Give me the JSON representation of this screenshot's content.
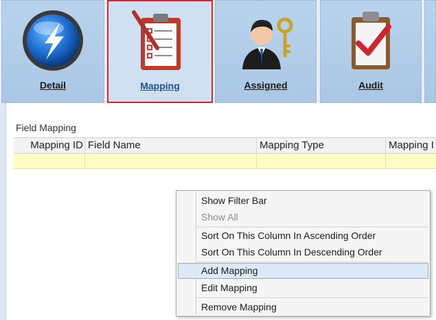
{
  "tabs": [
    {
      "label": "Detail",
      "icon": "lightning-globe-icon"
    },
    {
      "label": "Mapping",
      "icon": "clipboard-checklist-icon",
      "active": true
    },
    {
      "label": "Assigned",
      "icon": "user-key-icon"
    },
    {
      "label": "Audit",
      "icon": "clipboard-checkmark-icon"
    }
  ],
  "group": {
    "title": "Field Mapping"
  },
  "grid": {
    "columns": [
      "Mapping ID",
      "Field Name",
      "Mapping Type",
      "Mapping I"
    ]
  },
  "context_menu": {
    "items": [
      {
        "label": "Show Filter Bar"
      },
      {
        "label": "Show All",
        "disabled": true
      },
      {
        "label": "Sort On This Column In Ascending Order"
      },
      {
        "label": "Sort On This Column In Descending Order"
      },
      {
        "label": "Add Mapping",
        "hover": true
      },
      {
        "label": "Edit Mapping"
      },
      {
        "label": "Remove Mapping"
      }
    ]
  },
  "colors": {
    "active_tab_border": "#d9232e",
    "new_row": "#fefcc3",
    "menu_hover": "#dbe9f8"
  }
}
